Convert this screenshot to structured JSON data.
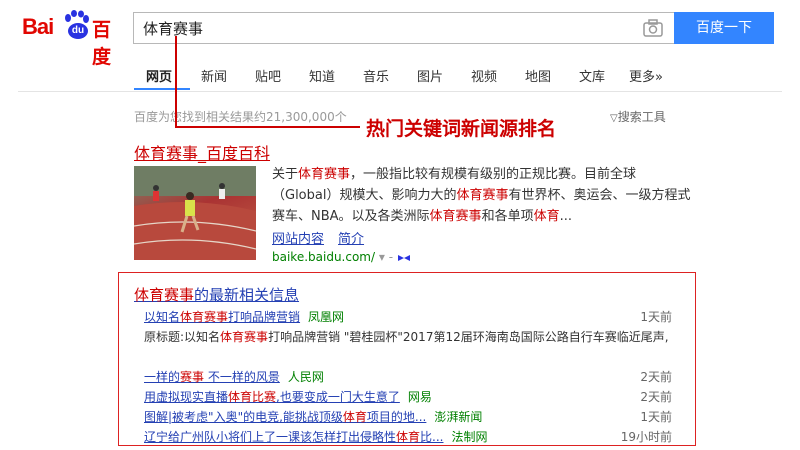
{
  "logo": {
    "bai": "Bai",
    "du": "du",
    "cn": "百度"
  },
  "search": {
    "value": "体育赛事",
    "button": "百度一下"
  },
  "tabs": [
    "网页",
    "新闻",
    "贴吧",
    "知道",
    "音乐",
    "图片",
    "视频",
    "地图",
    "文库",
    "更多»"
  ],
  "result_count": "百度为您找到相关结果约21,300,000个",
  "tools": "搜索工具",
  "annotation": "热门关键词新闻源排名",
  "result1": {
    "title_em": "体育赛事",
    "title_rest": "_百度百科",
    "snippet_1": "关于",
    "snippet_em1": "体育赛事",
    "snippet_2": "，一般指比较有规模有级别的正规比赛。目前全球（Global）规模大、影响力大的",
    "snippet_em2": "体育赛事",
    "snippet_3": "有世界杯、奥运会、一级方程式赛车、NBA。以及各类洲际",
    "snippet_em3": "体育赛事",
    "snippet_4": "和各单项",
    "snippet_em4": "体育",
    "snippet_5": "...",
    "link1": "网站内容",
    "link2": "简介",
    "url": "baike.baidu.com/",
    "url_arrow": "▾ -"
  },
  "news": {
    "title_em": "体育赛事",
    "title_rest": "的最新相关信息",
    "items": [
      {
        "a": "以知名",
        "em": "体育赛事",
        "b": "打响品牌营销",
        "source": "凤凰网",
        "time": "1天前"
      },
      {
        "a": "一样的",
        "em": "赛事",
        "b": " 不一样的风景",
        "source": "人民网",
        "time": "2天前"
      },
      {
        "a": "用虚拟现实直播",
        "em": "体育比赛",
        "b": ",也要变成一门大生意了",
        "source": "网易",
        "time": "2天前"
      },
      {
        "a": "图解|被考虑\"入奥\"的电竞,能挑战顶级",
        "em": "体育",
        "b": "项目的地...",
        "source": "澎湃新闻",
        "time": "1天前"
      },
      {
        "a": "辽宁给广州队小将们上了一课该怎样打出侵略性",
        "em": "体育",
        "b": "比...",
        "source": "法制网",
        "time": "19小时前"
      }
    ],
    "snippet_a": "原标题:以知名",
    "snippet_em": "体育赛事",
    "snippet_b": "打响品牌营销 \"碧桂园杯\"2017第12届环海南岛国际公路自行车赛临近尾声,"
  },
  "colors": {
    "accent": "#3385ff",
    "brand": "#e10601",
    "link": "#2440b3",
    "em": "#cc0000",
    "annotation": "#cc0000"
  }
}
